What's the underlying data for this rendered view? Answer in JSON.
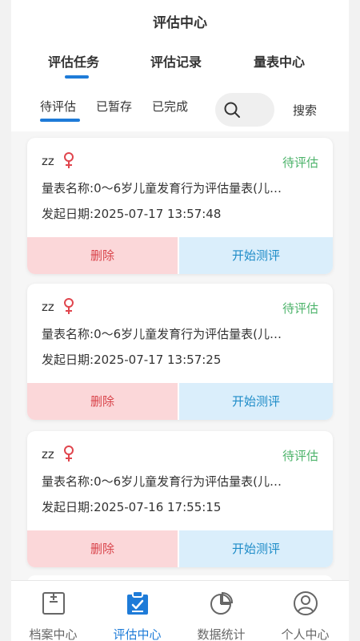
{
  "header": {
    "title": "评估中心"
  },
  "tabs": [
    {
      "label": "评估任务",
      "active": true
    },
    {
      "label": "评估记录",
      "active": false
    },
    {
      "label": "量表中心",
      "active": false
    }
  ],
  "subtabs": [
    {
      "label": "待评估",
      "active": true
    },
    {
      "label": "已暂存",
      "active": false
    },
    {
      "label": "已完成",
      "active": false
    }
  ],
  "search": {
    "placeholder": "",
    "button_label": "搜索",
    "icon": "search-icon"
  },
  "cards": [
    {
      "name": "zz",
      "gender_icon": "female-icon",
      "status": "待评估",
      "scale_label": "量表名称:",
      "scale_name": "0～6岁儿童发育行为评估量表(儿…",
      "date_label": "发起日期:",
      "date": "2025-07-17 13:57:48",
      "delete_label": "删除",
      "start_label": "开始测评"
    },
    {
      "name": "zz",
      "gender_icon": "female-icon",
      "status": "待评估",
      "scale_label": "量表名称:",
      "scale_name": "0～6岁儿童发育行为评估量表(儿…",
      "date_label": "发起日期:",
      "date": "2025-07-17 13:57:25",
      "delete_label": "删除",
      "start_label": "开始测评"
    },
    {
      "name": "zz",
      "gender_icon": "female-icon",
      "status": "待评估",
      "scale_label": "量表名称:",
      "scale_name": "0～6岁儿童发育行为评估量表(儿…",
      "date_label": "发起日期:",
      "date": "2025-07-16 17:55:15",
      "delete_label": "删除",
      "start_label": "开始测评"
    }
  ],
  "bottom_nav": [
    {
      "label": "档案中心",
      "icon": "archive-icon",
      "active": false
    },
    {
      "label": "评估中心",
      "icon": "clipboard-check-icon",
      "active": true
    },
    {
      "label": "数据统计",
      "icon": "pie-chart-icon",
      "active": false
    },
    {
      "label": "个人中心",
      "icon": "user-icon",
      "active": false
    }
  ],
  "colors": {
    "accent": "#1e7bd8",
    "status_pending": "#4cb36a",
    "female": "#e0454d",
    "delete_bg": "#fbd7d9",
    "delete_text": "#d9434a",
    "start_bg": "#daeefb",
    "start_text": "#1e8cc8"
  }
}
